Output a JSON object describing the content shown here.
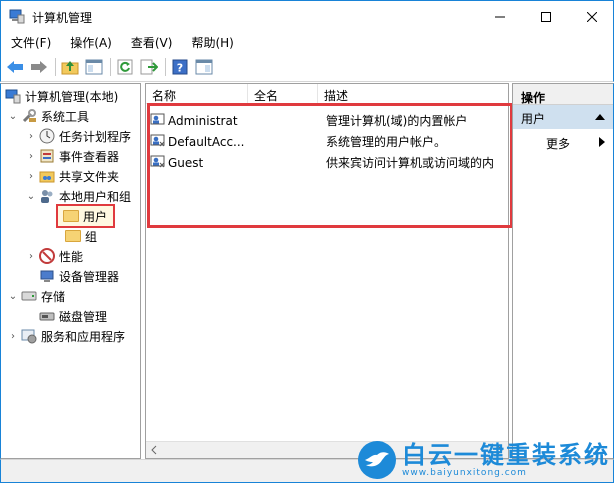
{
  "window": {
    "title": "计算机管理",
    "controls": {
      "minimize": "—",
      "maximize": "☐",
      "close": "✕"
    }
  },
  "menu": {
    "items": [
      "文件(F)",
      "操作(A)",
      "查看(V)",
      "帮助(H)"
    ]
  },
  "toolbar": {
    "icons": [
      "back-arrow-icon",
      "forward-arrow-icon",
      "up-folder-icon",
      "show-hide-tree-icon",
      "refresh-icon",
      "export-list-icon",
      "help-icon",
      "show-hide-action-pane-icon"
    ]
  },
  "tree": {
    "root": "计算机管理(本地)",
    "system_tools": "系统工具",
    "task_scheduler": "任务计划程序",
    "event_viewer": "事件查看器",
    "shared_folders": "共享文件夹",
    "local_users_groups": "本地用户和组",
    "users": "用户",
    "groups": "组",
    "performance": "性能",
    "device_manager": "设备管理器",
    "storage": "存储",
    "disk_management": "磁盘管理",
    "services_apps": "服务和应用程序"
  },
  "list": {
    "columns": [
      "名称",
      "全名",
      "描述"
    ],
    "rows": [
      {
        "name": "Administrat",
        "full_name": "",
        "description": "管理计算机(域)的内置帐户"
      },
      {
        "name": "DefaultAcc...",
        "full_name": "",
        "description": "系统管理的用户帐户。"
      },
      {
        "name": "Guest",
        "full_name": "",
        "description": "供来宾访问计算机或访问域的内"
      }
    ]
  },
  "actions": {
    "header": "操作",
    "selected": "用户",
    "more": "更多"
  },
  "watermark": {
    "brand": "白云一键重装系统",
    "url": "www.baiyunxitong.com"
  },
  "colors": {
    "accent": "#1883d7",
    "highlight_box": "#e03a3e",
    "action_selected": "#cfe0ef"
  }
}
